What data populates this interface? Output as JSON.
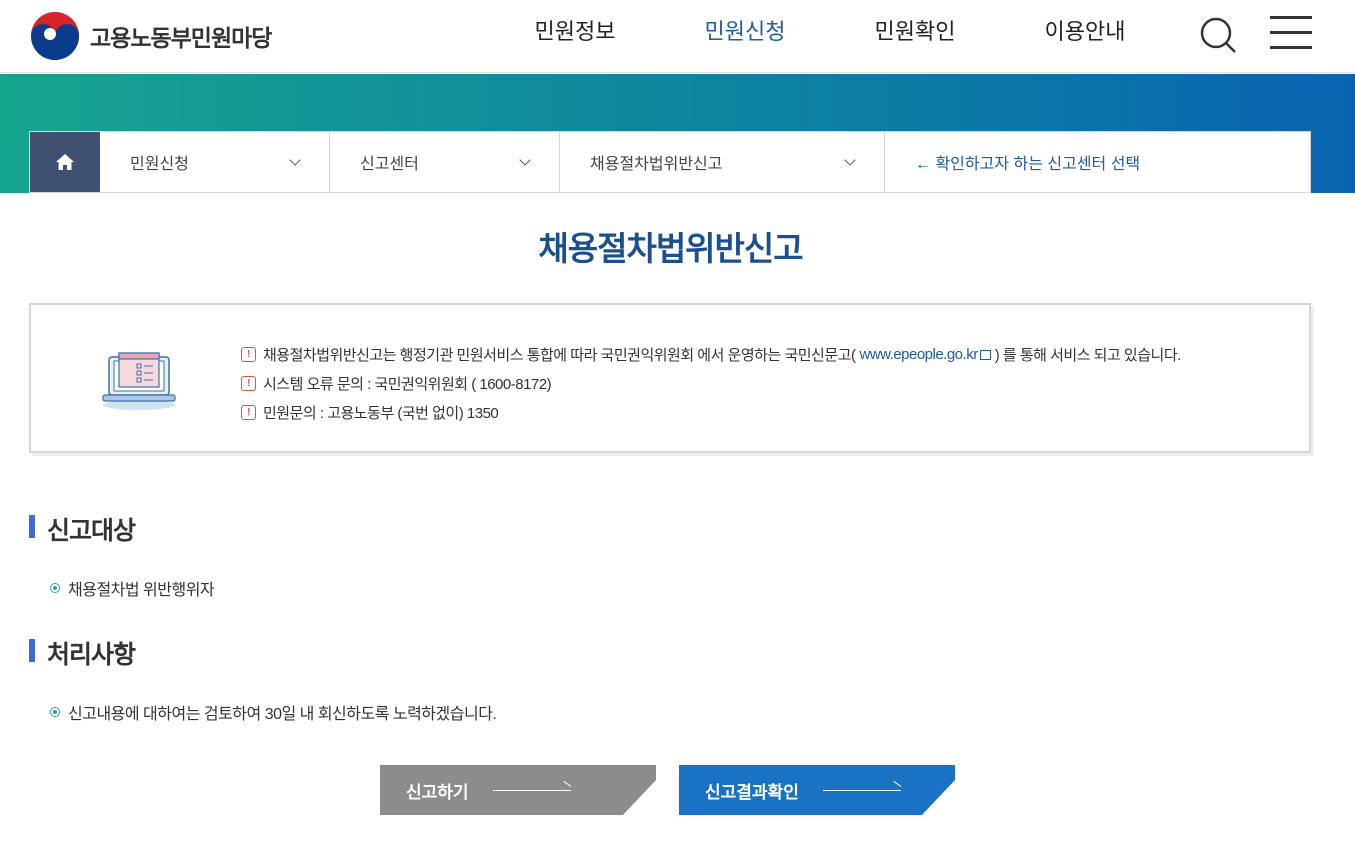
{
  "header": {
    "logo_text": "고용노동부민원마당",
    "nav": [
      {
        "label": "민원정보",
        "active": false
      },
      {
        "label": "민원신청",
        "active": true
      },
      {
        "label": "민원확인",
        "active": false
      },
      {
        "label": "이용안내",
        "active": false
      }
    ],
    "search_icon": "search-icon",
    "menu_icon": "hamburger-menu-icon"
  },
  "location": {
    "home_icon": "home-icon",
    "select1": "민원신청",
    "select2": "신고센터",
    "select3": "채용절차법위반신고",
    "guide": "← 확인하고자 하는 신고센터 선택"
  },
  "page": {
    "title": "채용절차법위반신고"
  },
  "info": {
    "line1_before": "채용절차법위반신고는 행정기관 민원서비스 통합에 따라 국민권익위원회 에서 운영하는 국민신문고(",
    "line1_link": "www.epeople.go.kr",
    "line1_after": ") 를 통해 서비스 되고 있습니다.",
    "line2": "시스템 오류 문의 : 국민권익위원회 ( 1600-8172)",
    "line3": "민원문의 : 고용노동부 (국번 없이) 1350",
    "warn_glyph": "!"
  },
  "sections": {
    "target_title": "신고대상",
    "target_item": "채용절차법 위반행위자",
    "process_title": "처리사항",
    "process_item": "신고내용에 대하여는 검토하여 30일 내 회신하도록 노력하겠습니다."
  },
  "buttons": {
    "report": "신고하기",
    "result": "신고결과확인"
  },
  "colors": {
    "accent_blue": "#1f5ba8",
    "title_blue": "#1b5090",
    "home_bg": "#3f5070",
    "button_gray": "#8c8c8c",
    "button_blue": "#1a72c4",
    "banner_start": "#16a58f",
    "banner_end": "#0a63b0"
  }
}
